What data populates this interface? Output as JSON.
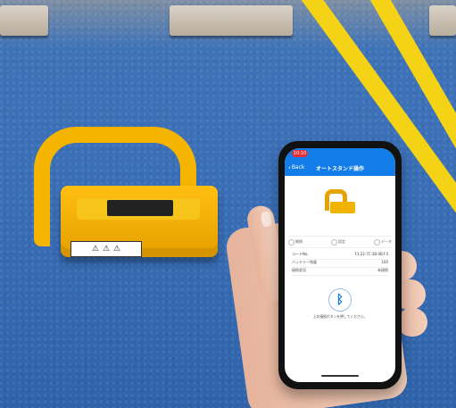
{
  "phone": {
    "status_time": "10:10",
    "back_label": "Back",
    "screen_title": "オートスタンド操作",
    "selector": [
      "開閉",
      "設定",
      "データ"
    ],
    "info_rows": [
      {
        "label": "コードNo.",
        "value": "F1:22:7C:3B:0B:F4"
      },
      {
        "label": "バッテリー残量",
        "value": "100"
      },
      {
        "label": "接続状況",
        "value": "未接続"
      }
    ],
    "bluetooth_hint": "上の接続ボタンを押してください。"
  },
  "device": {
    "warning_symbols": [
      "⚠",
      "⚠",
      "⚠"
    ]
  },
  "colors": {
    "app_blue": "#127de8",
    "device_yellow": "#f4b400",
    "floor_blue": "#3a6fb7",
    "lane_yellow": "#f4d317"
  }
}
